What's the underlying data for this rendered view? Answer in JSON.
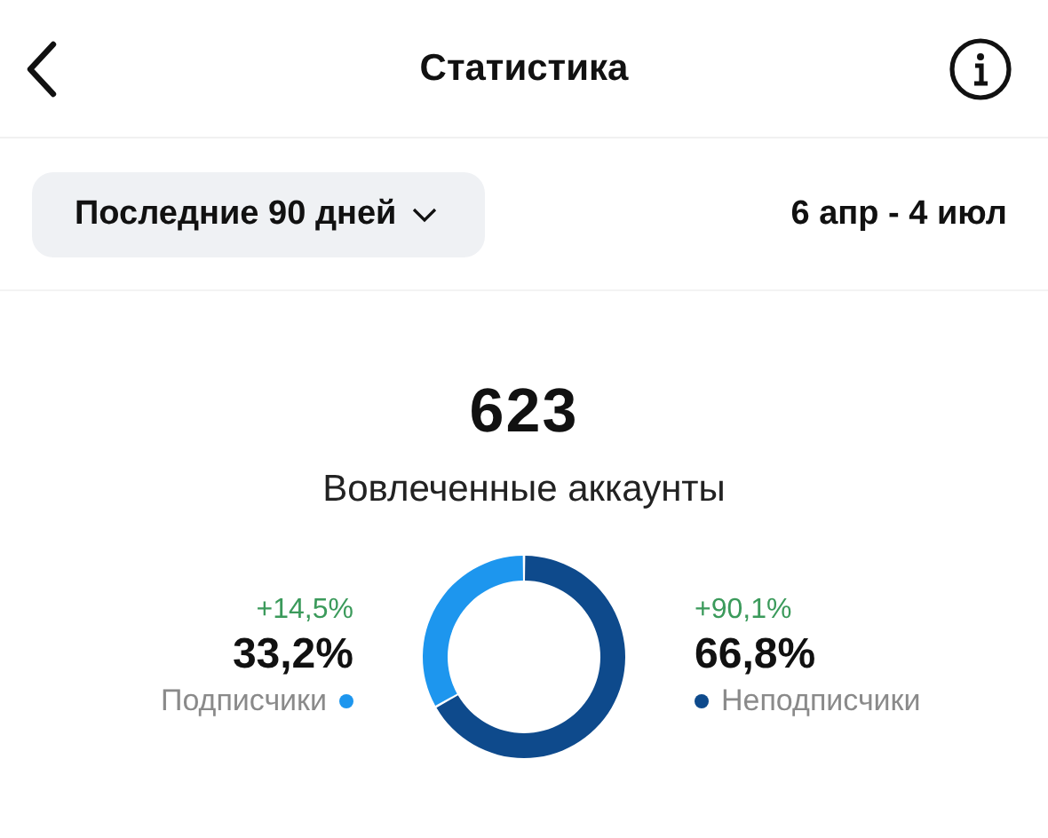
{
  "header": {
    "title": "Статистика"
  },
  "filter": {
    "label": "Последние 90 дней",
    "date_range": "6 апр - 4 июл"
  },
  "summary": {
    "value": "623",
    "label": "Вовлеченные аккаунты"
  },
  "segments": [
    {
      "change": "+14,5%",
      "share": "33,2%",
      "color": "#1d96ee"
    },
    {
      "change": "+90,1%",
      "share": "66,8%",
      "color": "#0e4a8c"
    }
  ],
  "chart_data": {
    "type": "donut",
    "categories": [
      "Подписчики",
      "Неподписчики"
    ],
    "values": [
      33.2,
      66.8
    ]
  }
}
